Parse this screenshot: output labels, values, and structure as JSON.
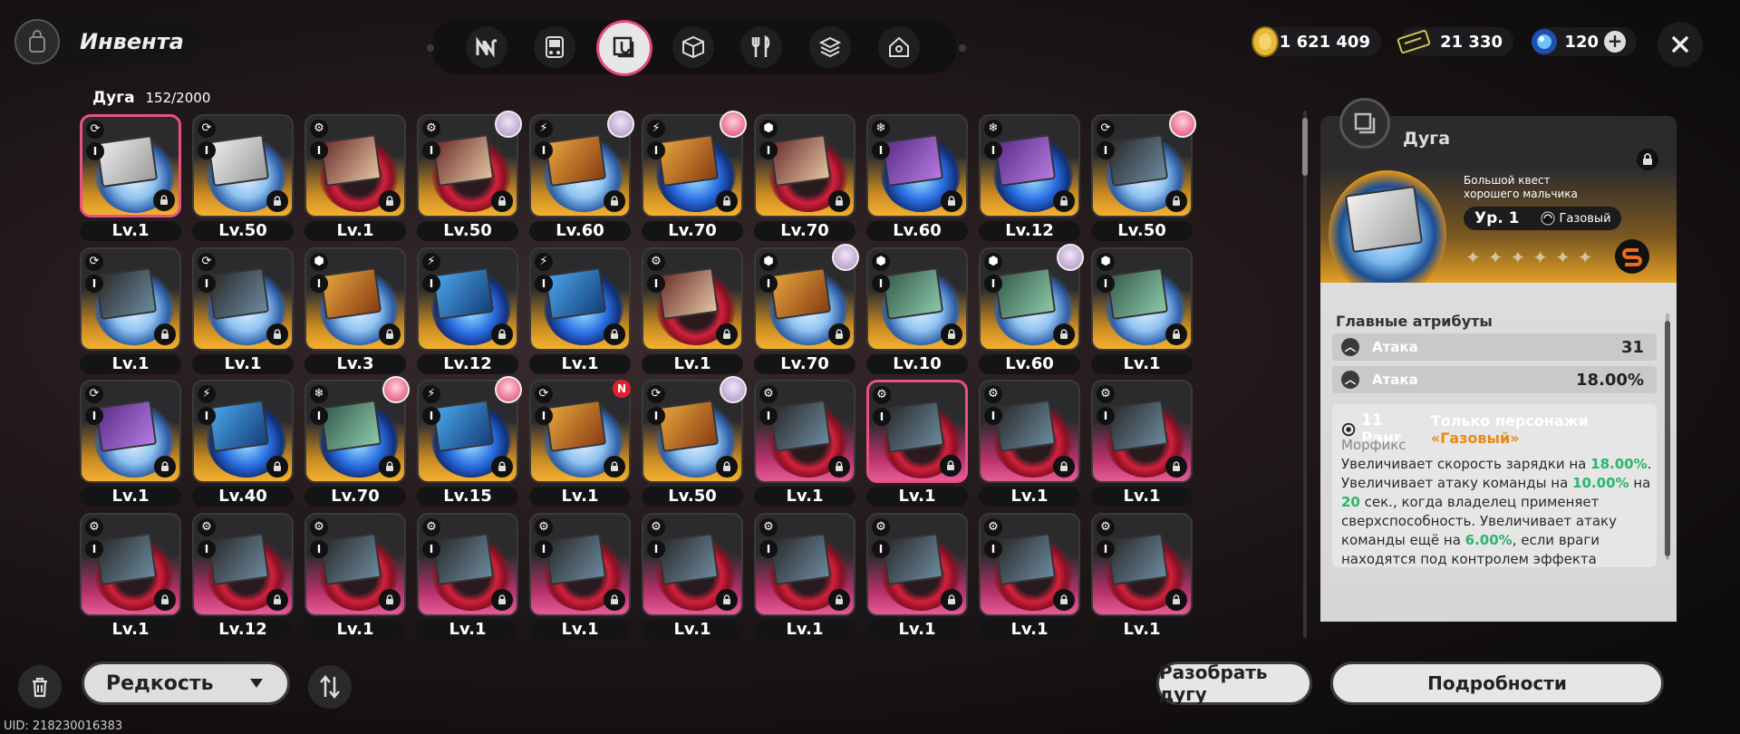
{
  "header": {
    "title": "Инвента",
    "nav_tabs": [
      {
        "icon": "agents-icon",
        "label": "Agents"
      },
      {
        "icon": "bangboo-icon",
        "label": "Bangboo"
      },
      {
        "icon": "w-engine-icon",
        "label": "W-Engines",
        "active": true
      },
      {
        "icon": "drive-disc-icon",
        "label": "Drive Discs"
      },
      {
        "icon": "food-icon",
        "label": "Food"
      },
      {
        "icon": "materials-icon",
        "label": "Materials"
      },
      {
        "icon": "home-icon",
        "label": "Home"
      }
    ],
    "currencies": [
      {
        "name": "denny",
        "value": "1 621 409"
      },
      {
        "name": "ticket",
        "value": "21 330"
      },
      {
        "name": "polychrome",
        "value": "120"
      }
    ]
  },
  "inventory": {
    "category": "Дуга",
    "count": "152/2000"
  },
  "items": [
    {
      "level": "Lv.1",
      "tier": "I",
      "rank": "s",
      "disc": "white",
      "cover": "c1",
      "elem": "⟳",
      "selected": true
    },
    {
      "level": "Lv.50",
      "tier": "I",
      "rank": "s",
      "disc": "white",
      "cover": "c1",
      "elem": "⟳"
    },
    {
      "level": "Lv.1",
      "tier": "I",
      "rank": "s",
      "disc": "red",
      "cover": "c2",
      "elem": "⚙"
    },
    {
      "level": "Lv.50",
      "tier": "I",
      "rank": "s",
      "disc": "red",
      "cover": "c2",
      "elem": "⚙",
      "avatar": "lavender"
    },
    {
      "level": "Lv.60",
      "tier": "I",
      "rank": "s",
      "disc": "white",
      "cover": "c7",
      "elem": "⚡",
      "avatar": "lavender"
    },
    {
      "level": "Lv.70",
      "tier": "I",
      "rank": "s",
      "disc": "blue",
      "cover": "c7",
      "elem": "⚡",
      "avatar": "pink"
    },
    {
      "level": "Lv.70",
      "tier": "I",
      "rank": "s",
      "disc": "red",
      "cover": "c2",
      "elem": "⬢"
    },
    {
      "level": "Lv.60",
      "tier": "I",
      "rank": "s",
      "disc": "blue",
      "cover": "c3",
      "elem": "❄"
    },
    {
      "level": "Lv.12",
      "tier": "I",
      "rank": "s",
      "disc": "blue",
      "cover": "c3",
      "elem": "❄"
    },
    {
      "level": "Lv.50",
      "tier": "I",
      "rank": "s",
      "disc": "white",
      "cover": "c6",
      "elem": "⟳",
      "avatar": "pink"
    },
    {
      "level": "Lv.1",
      "tier": "I",
      "rank": "s",
      "disc": "white",
      "cover": "c6",
      "elem": "⟳"
    },
    {
      "level": "Lv.1",
      "tier": "I",
      "rank": "s",
      "disc": "white",
      "cover": "c6",
      "elem": "⟳"
    },
    {
      "level": "Lv.3",
      "tier": "I",
      "rank": "s",
      "disc": "white",
      "cover": "c7",
      "elem": "⬢"
    },
    {
      "level": "Lv.12",
      "tier": "I",
      "rank": "s",
      "disc": "blue",
      "cover": "c5",
      "elem": "⚡"
    },
    {
      "level": "Lv.1",
      "tier": "I",
      "rank": "s",
      "disc": "blue",
      "cover": "c5",
      "elem": "⚡"
    },
    {
      "level": "Lv.1",
      "tier": "I",
      "rank": "s",
      "disc": "red",
      "cover": "c2",
      "elem": "⚙"
    },
    {
      "level": "Lv.70",
      "tier": "I",
      "rank": "s",
      "disc": "white",
      "cover": "c7",
      "elem": "⬢",
      "avatar": "lavender"
    },
    {
      "level": "Lv.10",
      "tier": "I",
      "rank": "s",
      "disc": "white",
      "cover": "c4",
      "elem": "⬢"
    },
    {
      "level": "Lv.60",
      "tier": "I",
      "rank": "s",
      "disc": "white",
      "cover": "c4",
      "elem": "⬢",
      "avatar": "lavender"
    },
    {
      "level": "Lv.1",
      "tier": "I",
      "rank": "s",
      "disc": "white",
      "cover": "c4",
      "elem": "⬢"
    },
    {
      "level": "Lv.1",
      "tier": "I",
      "rank": "s",
      "disc": "white",
      "cover": "c3",
      "elem": "⟳"
    },
    {
      "level": "Lv.40",
      "tier": "I",
      "rank": "s",
      "disc": "blue",
      "cover": "c5",
      "elem": "⚡"
    },
    {
      "level": "Lv.70",
      "tier": "I",
      "rank": "s",
      "disc": "blue",
      "cover": "c4",
      "elem": "❄",
      "avatar": "pink"
    },
    {
      "level": "Lv.15",
      "tier": "I",
      "rank": "s",
      "disc": "blue",
      "cover": "c5",
      "elem": "⚡",
      "avatar": "pink"
    },
    {
      "level": "Lv.1",
      "tier": "I",
      "rank": "s",
      "disc": "white",
      "cover": "c7",
      "elem": "⟳",
      "badge": "N"
    },
    {
      "level": "Lv.50",
      "tier": "I",
      "rank": "s",
      "disc": "white",
      "cover": "c7",
      "elem": "⟳",
      "avatar": "lavender"
    },
    {
      "level": "Lv.1",
      "tier": "I",
      "rank": "a",
      "disc": "red",
      "cover": "c6",
      "elem": "⚙"
    },
    {
      "level": "Lv.1",
      "tier": "I",
      "rank": "a",
      "disc": "red",
      "cover": "c6",
      "elem": "⚙",
      "outlined": true
    },
    {
      "level": "Lv.1",
      "tier": "I",
      "rank": "a",
      "disc": "red",
      "cover": "c6",
      "elem": "⚙"
    },
    {
      "level": "Lv.1",
      "tier": "I",
      "rank": "a",
      "disc": "red",
      "cover": "c6",
      "elem": "⚙"
    },
    {
      "level": "Lv.1",
      "tier": "I",
      "rank": "a",
      "disc": "red",
      "cover": "c6",
      "elem": "⚙"
    },
    {
      "level": "Lv.12",
      "tier": "I",
      "rank": "a",
      "disc": "red",
      "cover": "c6",
      "elem": "⚙"
    },
    {
      "level": "Lv.1",
      "tier": "I",
      "rank": "a",
      "disc": "red",
      "cover": "c6",
      "elem": "⚙"
    },
    {
      "level": "Lv.1",
      "tier": "I",
      "rank": "a",
      "disc": "red",
      "cover": "c6",
      "elem": "⚙"
    },
    {
      "level": "Lv.1",
      "tier": "I",
      "rank": "a",
      "disc": "red",
      "cover": "c6",
      "elem": "⚙"
    },
    {
      "level": "Lv.1",
      "tier": "I",
      "rank": "a",
      "disc": "red",
      "cover": "c6",
      "elem": "⚙"
    },
    {
      "level": "Lv.1",
      "tier": "I",
      "rank": "a",
      "disc": "red",
      "cover": "c6",
      "elem": "⚙"
    },
    {
      "level": "Lv.1",
      "tier": "I",
      "rank": "a",
      "disc": "red",
      "cover": "c6",
      "elem": "⚙"
    },
    {
      "level": "Lv.1",
      "tier": "I",
      "rank": "a",
      "disc": "red",
      "cover": "c6",
      "elem": "⚙"
    },
    {
      "level": "Lv.1",
      "tier": "I",
      "rank": "a",
      "disc": "red",
      "cover": "c6",
      "elem": "⚙"
    }
  ],
  "detail": {
    "name": "Дуга",
    "subtitle": "Большой квест хорошего мальчика",
    "level": "Ур. 1",
    "element": "Газовый",
    "stars": "✦✦✦✦✦✦",
    "attributes_title": "Главные атрибуты",
    "attributes": [
      {
        "name": "Атака",
        "value": "31"
      },
      {
        "name": "Атака",
        "value": "18.00%"
      }
    ],
    "skill": {
      "rank": "11 Ранг",
      "only": "Только персонажи",
      "only_element": "«Газовый»",
      "name": "Морфикс",
      "text_1": "Увеличивает скорость зарядки на ",
      "val_1": "18.00%",
      "text_2": ". Увеличивает атаку команды на ",
      "val_2": "10.00%",
      "text_3": " на ",
      "val_3": "20",
      "text_4": " сек., когда владелец применяет сверхспособность. Увеличивает атаку команды ещё на ",
      "val_4": "6.00%",
      "text_5": ", если враги находятся под контролем эффекта"
    }
  },
  "footer": {
    "sort_label": "Редкость",
    "dismantle_label": "Разобрать дугу",
    "details_label": "Подробности",
    "uid": "UID: 218230016383"
  },
  "colors": {
    "accent": "#e75186",
    "rank_s": "#f0a726",
    "rank_a": "#e65b96",
    "highlight_green": "#2ab56d",
    "highlight_orange": "#e88b15"
  }
}
